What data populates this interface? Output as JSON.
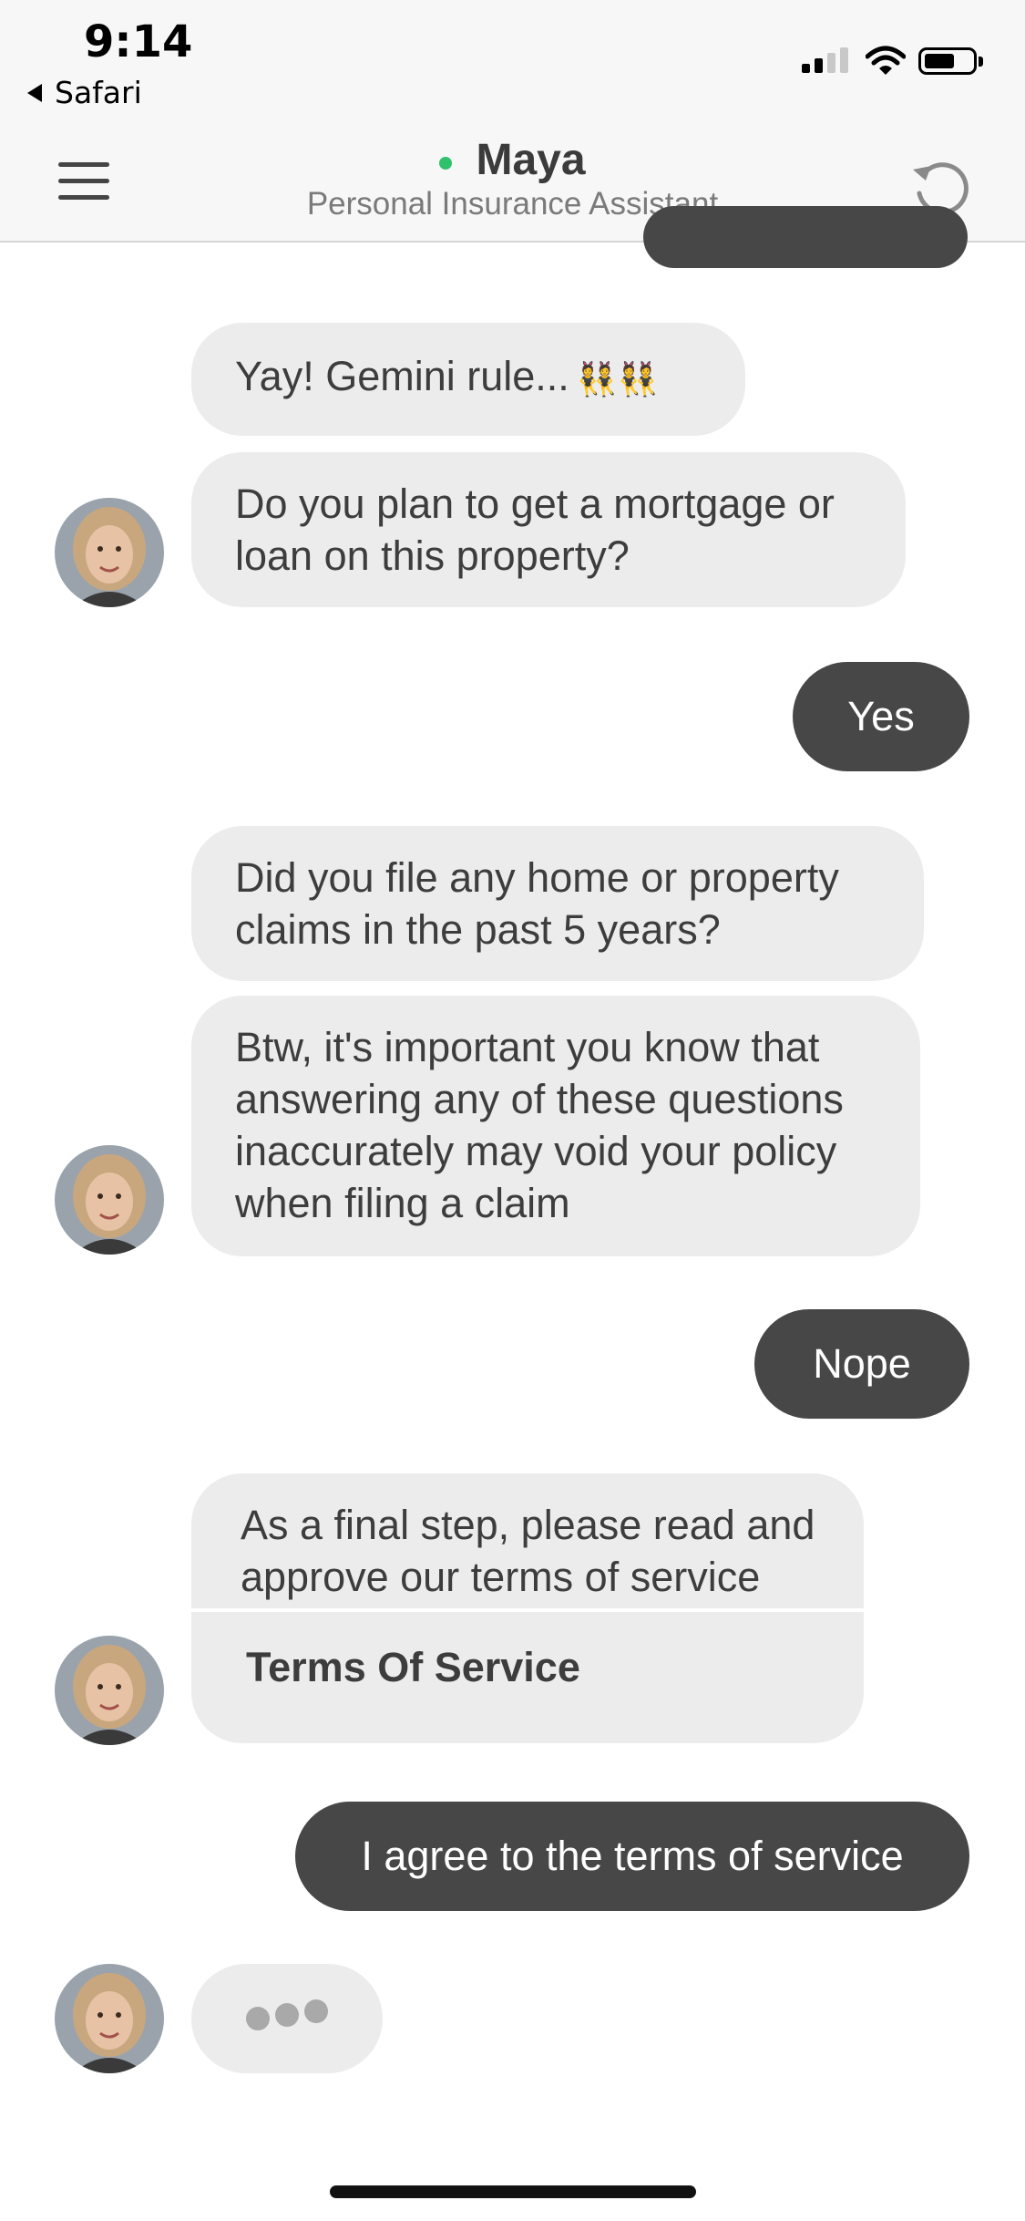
{
  "status_bar": {
    "time": "9:14",
    "back_app": "Safari"
  },
  "header": {
    "agent_name": "Maya",
    "agent_role": "Personal Insurance Assistant",
    "status_color": "#2fc26b"
  },
  "messages": {
    "m1": "Yay! Gemini rule...",
    "m1_emoji": "👯👯",
    "m2": "Do you plan to get a mortgage or loan on this property?",
    "m3": "Yes",
    "m4": "Did you file any home or property claims in the past 5 years?",
    "m5": "Btw, it's important you know that answering any of these questions inaccurately may void your policy when filing a claim",
    "m6": "Nope",
    "m7": "As a final step, please read and approve our terms of service",
    "m7_link": "Terms Of Service",
    "m8": "I agree to the terms of service"
  },
  "colors": {
    "bot_bubble": "#ececec",
    "user_bubble": "#474747"
  },
  "icons": [
    "menu-icon",
    "refresh-icon",
    "signal-icon",
    "wifi-icon",
    "battery-icon",
    "typing-indicator"
  ]
}
